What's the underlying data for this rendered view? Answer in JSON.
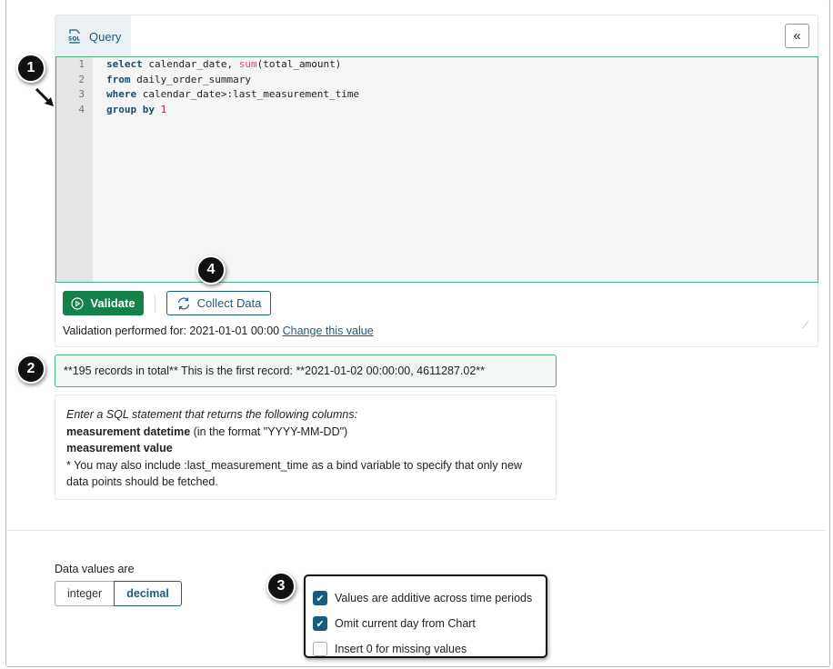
{
  "tab": {
    "label": "Query",
    "icon": "sql-file-icon"
  },
  "collapse_label": "«",
  "editor": {
    "line_numbers": [
      "1",
      "2",
      "3",
      "4"
    ]
  },
  "buttons": {
    "validate": "Validate",
    "collect": "Collect Data"
  },
  "validation": {
    "text": "Validation performed for: 2021-01-01 00:00",
    "link": "Change this value"
  },
  "result_text": "**195 records in total** This is the first record: **2021-01-02 00:00:00, 4611287.02**",
  "info": {
    "intro": "Enter a SQL statement that returns the following columns:",
    "col1": "measurement datetime",
    "col1_note": " (in the format \"YYYY-MM-DD\")",
    "col2": "measurement value",
    "note": "* You may also include :last_measurement_time as a bind variable to specify that only new data points should be fetched."
  },
  "data_values": {
    "label": "Data values are",
    "options": [
      "integer",
      "decimal"
    ],
    "selected": "decimal"
  },
  "checkboxes": [
    {
      "label": "Values are additive across time periods",
      "checked": true
    },
    {
      "label": "Omit current day from Chart",
      "checked": true
    },
    {
      "label": "Insert 0 for missing values",
      "checked": false
    }
  ],
  "callouts": [
    "1",
    "2",
    "3",
    "4"
  ]
}
